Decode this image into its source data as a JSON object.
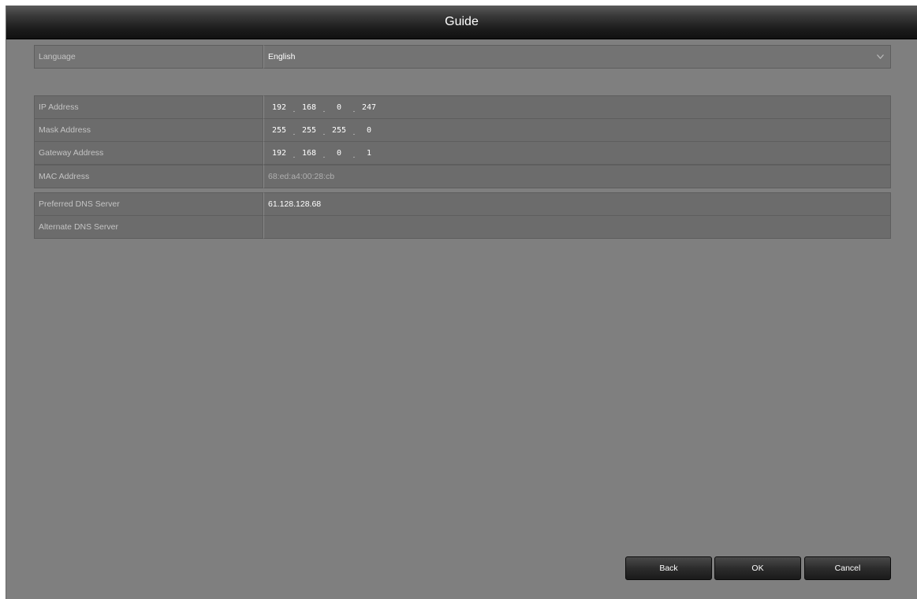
{
  "window": {
    "title": "Guide"
  },
  "language": {
    "label": "Language",
    "value": "English"
  },
  "network": {
    "ip": {
      "label": "IP Address",
      "octets": [
        "192",
        "168",
        "0",
        "247"
      ]
    },
    "mask": {
      "label": "Mask Address",
      "octets": [
        "255",
        "255",
        "255",
        "0"
      ]
    },
    "gateway": {
      "label": "Gateway Address",
      "octets": [
        "192",
        "168",
        "0",
        "1"
      ]
    },
    "mac": {
      "label": "MAC Address",
      "value": "68:ed:a4:00:28:cb"
    }
  },
  "dns": {
    "preferred": {
      "label": "Preferred DNS Server",
      "value": "61.128.128.68"
    },
    "alternate": {
      "label": "Alternate DNS Server",
      "value": ""
    }
  },
  "buttons": {
    "back": "Back",
    "ok": "OK",
    "cancel": "Cancel"
  },
  "colors": {
    "background": "#7f7f7f",
    "row": "#6c6c6c",
    "titlebar": "#1c1c1c"
  }
}
